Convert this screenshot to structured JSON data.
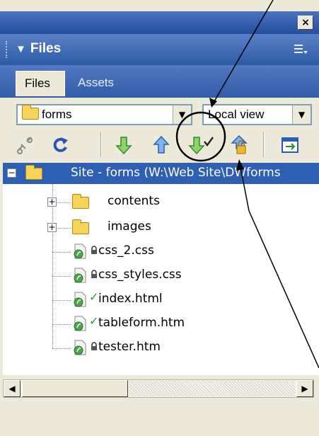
{
  "panel": {
    "close_label": "×",
    "title": "Files",
    "tabs": [
      {
        "label": "Files",
        "active": true
      },
      {
        "label": "Assets",
        "active": false
      }
    ]
  },
  "site_select": {
    "value": "forms"
  },
  "view_select": {
    "value": "Local view"
  },
  "toolbar": {
    "icons": [
      "connect-icon",
      "refresh-icon",
      "get-icon",
      "put-icon",
      "check-out-icon",
      "check-in-icon",
      "expand-icon"
    ]
  },
  "tree": {
    "root": "Site - forms (W:\\Web Site\\DWforms",
    "items": [
      {
        "name": "contents",
        "type": "folder"
      },
      {
        "name": "images",
        "type": "folder"
      },
      {
        "name": "css_2.css",
        "type": "file",
        "status": "locked"
      },
      {
        "name": "css_styles.css",
        "type": "file",
        "status": "locked"
      },
      {
        "name": "index.html",
        "type": "file",
        "status": "checked-out"
      },
      {
        "name": "tableform.htm",
        "type": "file",
        "status": "checked-out"
      },
      {
        "name": "tester.htm",
        "type": "file",
        "status": "locked"
      }
    ]
  },
  "colors": {
    "panel_bg": "#ece9d8",
    "header_blue": "#2d5aa6",
    "selection_blue": "#2f5fb3",
    "check_green": "#2f9a2f"
  }
}
